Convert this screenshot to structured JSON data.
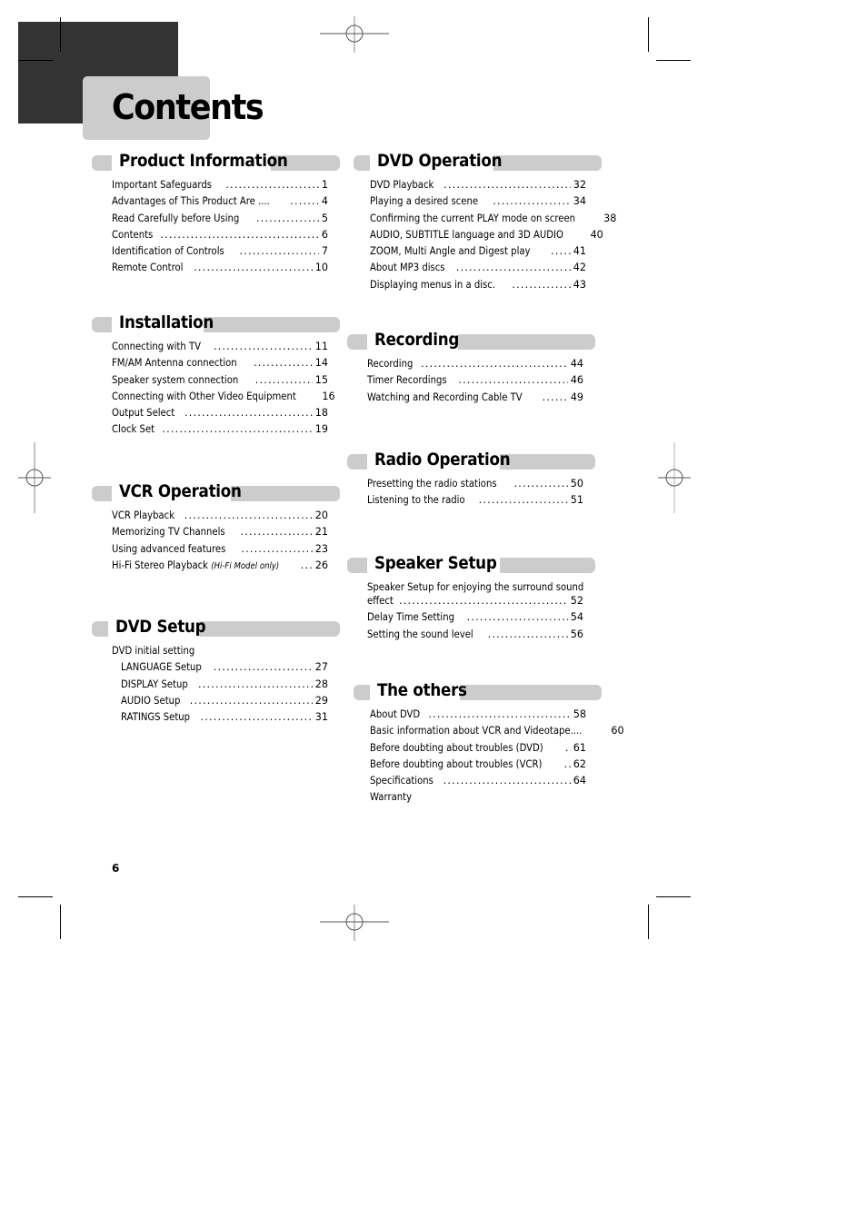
{
  "page": {
    "title": "Contents",
    "page_number": "6"
  },
  "sections": {
    "product_information": {
      "title": "Product Information",
      "items": [
        {
          "label": "Important Safeguards",
          "page": "1"
        },
        {
          "label": "Advantages of This Product Are ....",
          "page": "4"
        },
        {
          "label": "Read Carefully before Using",
          "page": "5"
        },
        {
          "label": "Contents",
          "page": "6"
        },
        {
          "label": "Identification of Controls",
          "page": "7"
        },
        {
          "label": "Remote Control",
          "page": "10"
        }
      ]
    },
    "installation": {
      "title": "Installation",
      "items": [
        {
          "label": "Connecting with TV",
          "page": "11"
        },
        {
          "label": "FM/AM  Antenna connection",
          "page": "14"
        },
        {
          "label": "Speaker system connection",
          "page": "15"
        },
        {
          "label": "Connecting with Other Video Equipment",
          "page": "16"
        },
        {
          "label": "Output Select",
          "page": "18"
        },
        {
          "label": "Clock Set",
          "page": "19"
        }
      ]
    },
    "vcr_operation": {
      "title": "VCR Operation",
      "items": [
        {
          "label": "VCR Playback",
          "page": "20"
        },
        {
          "label": "Memorizing TV Channels",
          "page": "21"
        },
        {
          "label": "Using advanced features",
          "page": "23"
        },
        {
          "label": "Hi-Fi Stereo Playback",
          "note": "(Hi-Fi Model only)",
          "page": "26"
        }
      ]
    },
    "dvd_setup": {
      "title": "DVD Setup",
      "group_label": "DVD initial setting",
      "items": [
        {
          "label": "LANGUAGE Setup",
          "page": "27"
        },
        {
          "label": "DISPLAY Setup",
          "page": "28"
        },
        {
          "label": "AUDIO Setup",
          "page": "29"
        },
        {
          "label": "RATINGS Setup",
          "page": "31"
        }
      ]
    },
    "dvd_operation": {
      "title": "DVD Operation",
      "items": [
        {
          "label": "DVD Playback",
          "page": "32"
        },
        {
          "label": "Playing a desired scene",
          "page": "34"
        },
        {
          "label": "Confirming the current PLAY mode on screen",
          "page": "38"
        },
        {
          "label": "AUDIO, SUBTITLE language and 3D AUDIO",
          "page": "40"
        },
        {
          "label": "ZOOM, Multi Angle and Digest play",
          "page": "41"
        },
        {
          "label": "About MP3 discs",
          "page": "42"
        },
        {
          "label": "Displaying menus in a disc.",
          "page": "43"
        }
      ]
    },
    "recording": {
      "title": "Recording",
      "items": [
        {
          "label": "Recording",
          "page": "44"
        },
        {
          "label": "Timer Recordings",
          "page": "46"
        },
        {
          "label": "Watching and Recording Cable TV",
          "page": "49"
        }
      ]
    },
    "radio_operation": {
      "title": "Radio Operation",
      "items": [
        {
          "label": "Presetting the radio stations",
          "page": "50"
        },
        {
          "label": "Listening to the radio",
          "page": "51"
        }
      ]
    },
    "speaker_setup": {
      "title": "Speaker Setup",
      "items": [
        {
          "label_line1": "Speaker Setup for enjoying the surround sound",
          "label": "effect",
          "page": "52"
        },
        {
          "label": "Delay Time Setting",
          "page": "54"
        },
        {
          "label": "Setting the sound level",
          "page": "56"
        }
      ]
    },
    "the_others": {
      "title": "The others",
      "items": [
        {
          "label": "About DVD",
          "page": "58"
        },
        {
          "label": "Basic information about VCR and Videotape....",
          "page": "60"
        },
        {
          "label": "Before doubting about troubles (DVD)",
          "page": "61"
        },
        {
          "label": "Before doubting about troubles (VCR)",
          "page": "62"
        },
        {
          "label": "Specifications",
          "page": "64"
        },
        {
          "label": "Warranty",
          "page": ""
        }
      ]
    }
  }
}
